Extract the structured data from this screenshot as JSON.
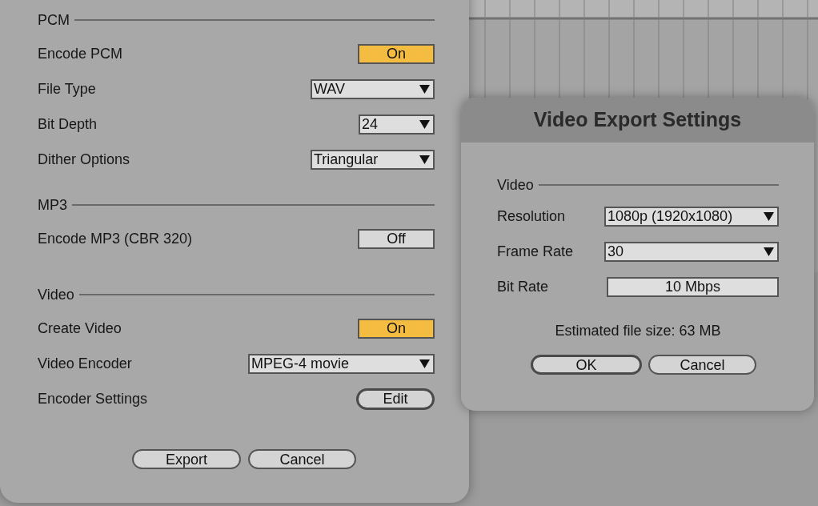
{
  "export_dialog": {
    "sections": [
      {
        "title": "PCM",
        "rows": [
          {
            "label": "Encode PCM",
            "kind": "toggle",
            "value": "On",
            "on": true
          },
          {
            "label": "File Type",
            "kind": "dropdown",
            "value": "WAV"
          },
          {
            "label": "Bit Depth",
            "kind": "dropdown",
            "value": "24"
          },
          {
            "label": "Dither Options",
            "kind": "dropdown",
            "value": "Triangular"
          }
        ]
      },
      {
        "title": "MP3",
        "rows": [
          {
            "label": "Encode MP3 (CBR 320)",
            "kind": "toggle",
            "value": "Off",
            "on": false
          }
        ]
      },
      {
        "title": "Video",
        "rows": [
          {
            "label": "Create Video",
            "kind": "toggle",
            "value": "On",
            "on": true
          },
          {
            "label": "Video Encoder",
            "kind": "dropdown",
            "value": "MPEG-4 movie"
          },
          {
            "label": "Encoder Settings",
            "kind": "button",
            "value": "Edit",
            "focused": true
          }
        ]
      }
    ],
    "buttons": [
      {
        "label": "Export",
        "focused": false
      },
      {
        "label": "Cancel",
        "focused": false
      }
    ]
  },
  "video_dialog": {
    "title": "Video Export Settings",
    "section": "Video",
    "rows": [
      {
        "label": "Resolution",
        "kind": "dropdown",
        "value": "1080p (1920x1080)"
      },
      {
        "label": "Frame Rate",
        "kind": "dropdown",
        "value": "30"
      },
      {
        "label": "Bit Rate",
        "kind": "field",
        "value": "10 Mbps"
      }
    ],
    "estimate": "Estimated file size: 63 MB",
    "buttons": [
      {
        "label": "OK",
        "focused": true
      },
      {
        "label": "Cancel",
        "focused": false
      }
    ]
  }
}
